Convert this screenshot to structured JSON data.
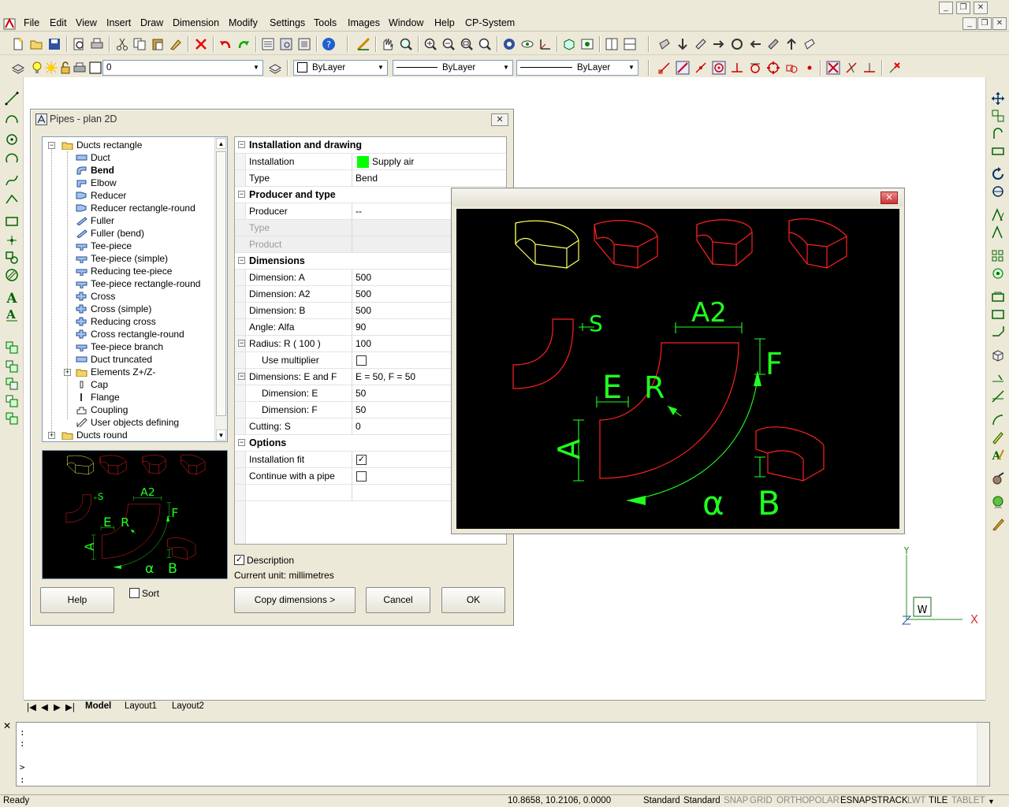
{
  "menu": {
    "items": [
      "File",
      "Edit",
      "View",
      "Insert",
      "Draw",
      "Dimension",
      "Modify",
      "Settings",
      "Tools",
      "Images",
      "Window",
      "Help",
      "CP-System"
    ]
  },
  "toolbar2": {
    "layer_value": "0",
    "color_value": "ByLayer",
    "linetype_value": "ByLayer",
    "lineweight_value": "ByLayer"
  },
  "dialog": {
    "title": "Pipes - plan 2D",
    "tree": [
      {
        "label": "Ducts rectangle",
        "level": 0,
        "icon": "folder-icon",
        "expanded": true
      },
      {
        "label": "Duct",
        "level": 1,
        "icon": "duct-icon"
      },
      {
        "label": "Bend",
        "level": 1,
        "icon": "bend-icon",
        "selected": true
      },
      {
        "label": "Elbow",
        "level": 1,
        "icon": "elbow-icon"
      },
      {
        "label": "Reducer",
        "level": 1,
        "icon": "reducer-icon"
      },
      {
        "label": "Reducer rectangle-round",
        "level": 1,
        "icon": "reducer-icon"
      },
      {
        "label": "Fuller",
        "level": 1,
        "icon": "fuller-icon"
      },
      {
        "label": "Fuller (bend)",
        "level": 1,
        "icon": "fuller-icon"
      },
      {
        "label": "Tee-piece",
        "level": 1,
        "icon": "tee-icon"
      },
      {
        "label": "Tee-piece (simple)",
        "level": 1,
        "icon": "tee-icon"
      },
      {
        "label": "Reducing tee-piece",
        "level": 1,
        "icon": "tee-icon"
      },
      {
        "label": "Tee-piece rectangle-round",
        "level": 1,
        "icon": "tee-icon"
      },
      {
        "label": "Cross",
        "level": 1,
        "icon": "cross-icon"
      },
      {
        "label": "Cross (simple)",
        "level": 1,
        "icon": "cross-icon"
      },
      {
        "label": "Reducing cross",
        "level": 1,
        "icon": "cross-icon"
      },
      {
        "label": "Cross rectangle-round",
        "level": 1,
        "icon": "cross-icon"
      },
      {
        "label": "Tee-piece branch",
        "level": 1,
        "icon": "tee-icon"
      },
      {
        "label": "Duct truncated",
        "level": 1,
        "icon": "duct-icon"
      },
      {
        "label": "Elements Z+/Z-",
        "level": 1,
        "icon": "folder-icon",
        "collapsed": true
      },
      {
        "label": "Cap",
        "level": 1,
        "icon": "cap-icon"
      },
      {
        "label": "Flange",
        "level": 1,
        "icon": "flange-icon"
      },
      {
        "label": "Coupling",
        "level": 1,
        "icon": "coupling-icon"
      },
      {
        "label": "User objects defining",
        "level": 1,
        "icon": "user-object-icon"
      },
      {
        "label": "Ducts round",
        "level": 0,
        "icon": "folder-icon",
        "collapsed": true
      },
      {
        "label": "",
        "level": 0,
        "icon": "folder-icon"
      }
    ],
    "props": [
      {
        "type": "hdr",
        "label": "Installation and drawing"
      },
      {
        "type": "row",
        "label": "Installation",
        "value": "Supply air",
        "swatch": "#00ff00"
      },
      {
        "type": "row",
        "label": "Type",
        "value": "Bend"
      },
      {
        "type": "hdr",
        "label": "Producer and type"
      },
      {
        "type": "row",
        "label": "Producer",
        "value": "--"
      },
      {
        "type": "dis",
        "label": "Type",
        "value": ""
      },
      {
        "type": "dis",
        "label": "Product",
        "value": ""
      },
      {
        "type": "hdr",
        "label": "Dimensions"
      },
      {
        "type": "row",
        "label": "Dimension: A",
        "value": "500"
      },
      {
        "type": "row",
        "label": "Dimension: A2",
        "value": "500"
      },
      {
        "type": "row",
        "label": "Dimension: B",
        "value": "500"
      },
      {
        "type": "row",
        "label": "Angle: Alfa",
        "value": "90"
      },
      {
        "type": "grp",
        "label": "Radius: R  ( 100 )",
        "value": "100"
      },
      {
        "type": "sub",
        "label": "Use multiplier",
        "check": false
      },
      {
        "type": "grp",
        "label": "Dimensions: E and F",
        "value": "E = 50,  F = 50"
      },
      {
        "type": "sub",
        "label": "Dimension: E",
        "value": "50"
      },
      {
        "type": "sub",
        "label": "Dimension: F",
        "value": "50"
      },
      {
        "type": "row",
        "label": "Cutting: S",
        "value": "0"
      },
      {
        "type": "hdr",
        "label": "Options"
      },
      {
        "type": "row",
        "label": "Installation fit",
        "check": true
      },
      {
        "type": "row",
        "label": "Continue with a pipe",
        "check": false
      },
      {
        "type": "row",
        "label": "",
        "value": ""
      }
    ],
    "description_label": "Description",
    "description_checked": true,
    "current_unit": "Current unit: millimetres",
    "sort_label": "Sort",
    "buttons": {
      "help": "Help",
      "copy": "Copy dimensions  >",
      "cancel": "Cancel",
      "ok": "OK"
    },
    "preview_labels": {
      "s": "S",
      "a2": "A2",
      "f": "F",
      "e": "E",
      "r": "R",
      "a": "A",
      "b": "B",
      "alpha": "α"
    }
  },
  "ucs": {
    "y": "Y",
    "x": "X",
    "w": "W"
  },
  "tabs": [
    "Model",
    "Layout1",
    "Layout2"
  ],
  "command": {
    "lines": [
      ":",
      ":",
      ">",
      ":"
    ]
  },
  "status": {
    "ready": "Ready",
    "coords": "10.8658, 10.2106, 0.0000",
    "toggles": [
      {
        "label": "Standard",
        "on": true
      },
      {
        "label": "Standard",
        "on": true
      },
      {
        "label": "SNAP",
        "on": false
      },
      {
        "label": "GRID",
        "on": false
      },
      {
        "label": "ORTHO",
        "on": false
      },
      {
        "label": "POLAR",
        "on": false
      },
      {
        "label": "ESNAP",
        "on": true
      },
      {
        "label": "STRACK",
        "on": true
      },
      {
        "label": "LWT",
        "on": false
      },
      {
        "label": "TILE",
        "on": true
      },
      {
        "label": "TABLET",
        "on": false
      }
    ]
  },
  "colors": {
    "bend_red": "#ff2020",
    "bend_yellow": "#ffff60",
    "dim_green": "#20ff20",
    "accent": "#0055e5"
  }
}
